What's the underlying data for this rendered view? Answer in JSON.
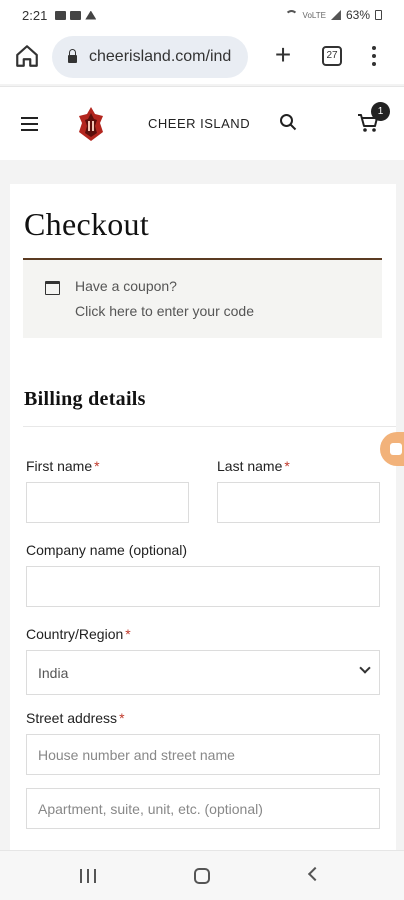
{
  "status_bar": {
    "time": "2:21",
    "battery": "63%",
    "network": "VoLTE"
  },
  "browser": {
    "url": "cheerisland.com/ind",
    "tab_count": "27"
  },
  "site": {
    "name": "CHEER ISLAND",
    "cart_count": "1"
  },
  "page": {
    "title": "Checkout"
  },
  "coupon": {
    "line1": "Have a coupon?",
    "line2": "Click here to enter your code"
  },
  "billing": {
    "title": "Billing details",
    "required_mark": "*",
    "first_name_label": "First name",
    "last_name_label": "Last name",
    "company_label": "Company name (optional)",
    "country_label": "Country/Region",
    "country_value": "India",
    "street_label": "Street address",
    "street_placeholder": "House number and street name",
    "apartment_placeholder": "Apartment, suite, unit, etc. (optional)"
  },
  "colors": {
    "accent_rule": "#5b3b22",
    "required": "#c0392b",
    "chat_tab": "#f2b27a"
  }
}
